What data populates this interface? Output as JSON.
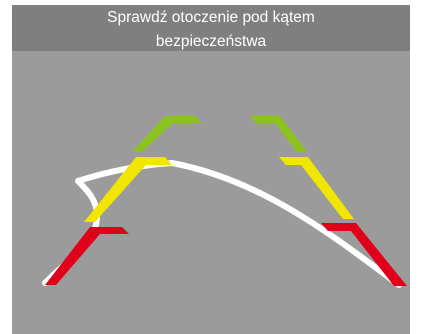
{
  "camera_view": {
    "warning_line1": "Sprawdź otoczenie pod kątem",
    "warning_line2": "bezpieczeństwa"
  },
  "colors": {
    "background": "#9b9b9b",
    "banner": "#7f7f7f",
    "guide_near": "#e1001a",
    "guide_mid": "#f0e600",
    "guide_far": "#8cc21e",
    "trajectory": "#ffffff"
  }
}
